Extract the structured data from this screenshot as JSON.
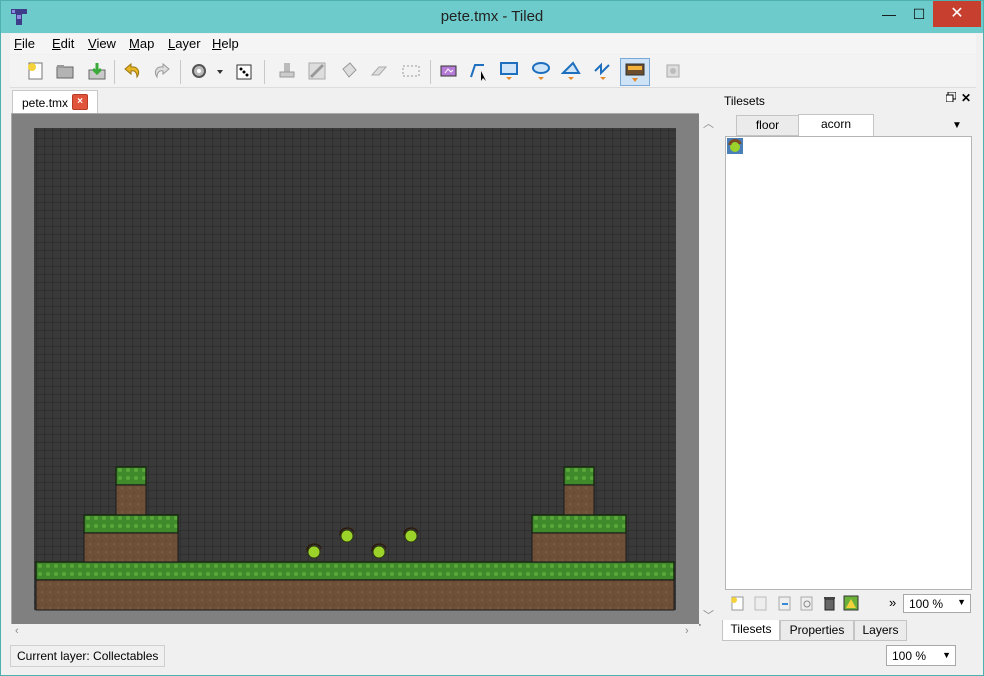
{
  "window": {
    "title": "pete.tmx - Tiled",
    "controls": {
      "minimize": "—",
      "maximize": "☐",
      "close": "✕"
    }
  },
  "menubar": {
    "items": [
      {
        "label": "File"
      },
      {
        "label": "Edit"
      },
      {
        "label": "View"
      },
      {
        "label": "Map"
      },
      {
        "label": "Layer"
      },
      {
        "label": "Help"
      }
    ]
  },
  "toolbar": {
    "tools": [
      "new-map-icon",
      "open-file-icon",
      "save-file-icon",
      "undo-icon",
      "redo-icon",
      "command-gear-icon",
      "random-dice-icon",
      "stamp-brush-icon",
      "terrain-brush-icon",
      "bucket-fill-icon",
      "eraser-icon",
      "rect-select-icon",
      "select-objects-icon",
      "edit-polygons-icon",
      "insert-rectangle-icon",
      "insert-ellipse-icon",
      "insert-polygon-icon",
      "insert-polyline-icon",
      "insert-tile-icon",
      "magic-wand-icon"
    ],
    "active_tool": "insert-tile-icon"
  },
  "document": {
    "tab_label": "pete.tmx",
    "close_label": "×"
  },
  "tilesets_panel": {
    "title": "Tilesets",
    "tabs": [
      {
        "label": "floor"
      },
      {
        "label": "acorn"
      }
    ],
    "selected_tab": "acorn",
    "zoom": "100 %",
    "more_label": "»"
  },
  "bottom_tabs": [
    {
      "label": "Tilesets"
    },
    {
      "label": "Properties"
    },
    {
      "label": "Layers"
    }
  ],
  "statusbar": {
    "current_layer": "Current layer: Collectables",
    "zoom": "100 %"
  },
  "colors": {
    "titlebar": "#6ecbcb",
    "map_background": "#393939",
    "grass": "#3f8a2a",
    "dirt": "#6e5038",
    "close_button": "#c7402f"
  }
}
